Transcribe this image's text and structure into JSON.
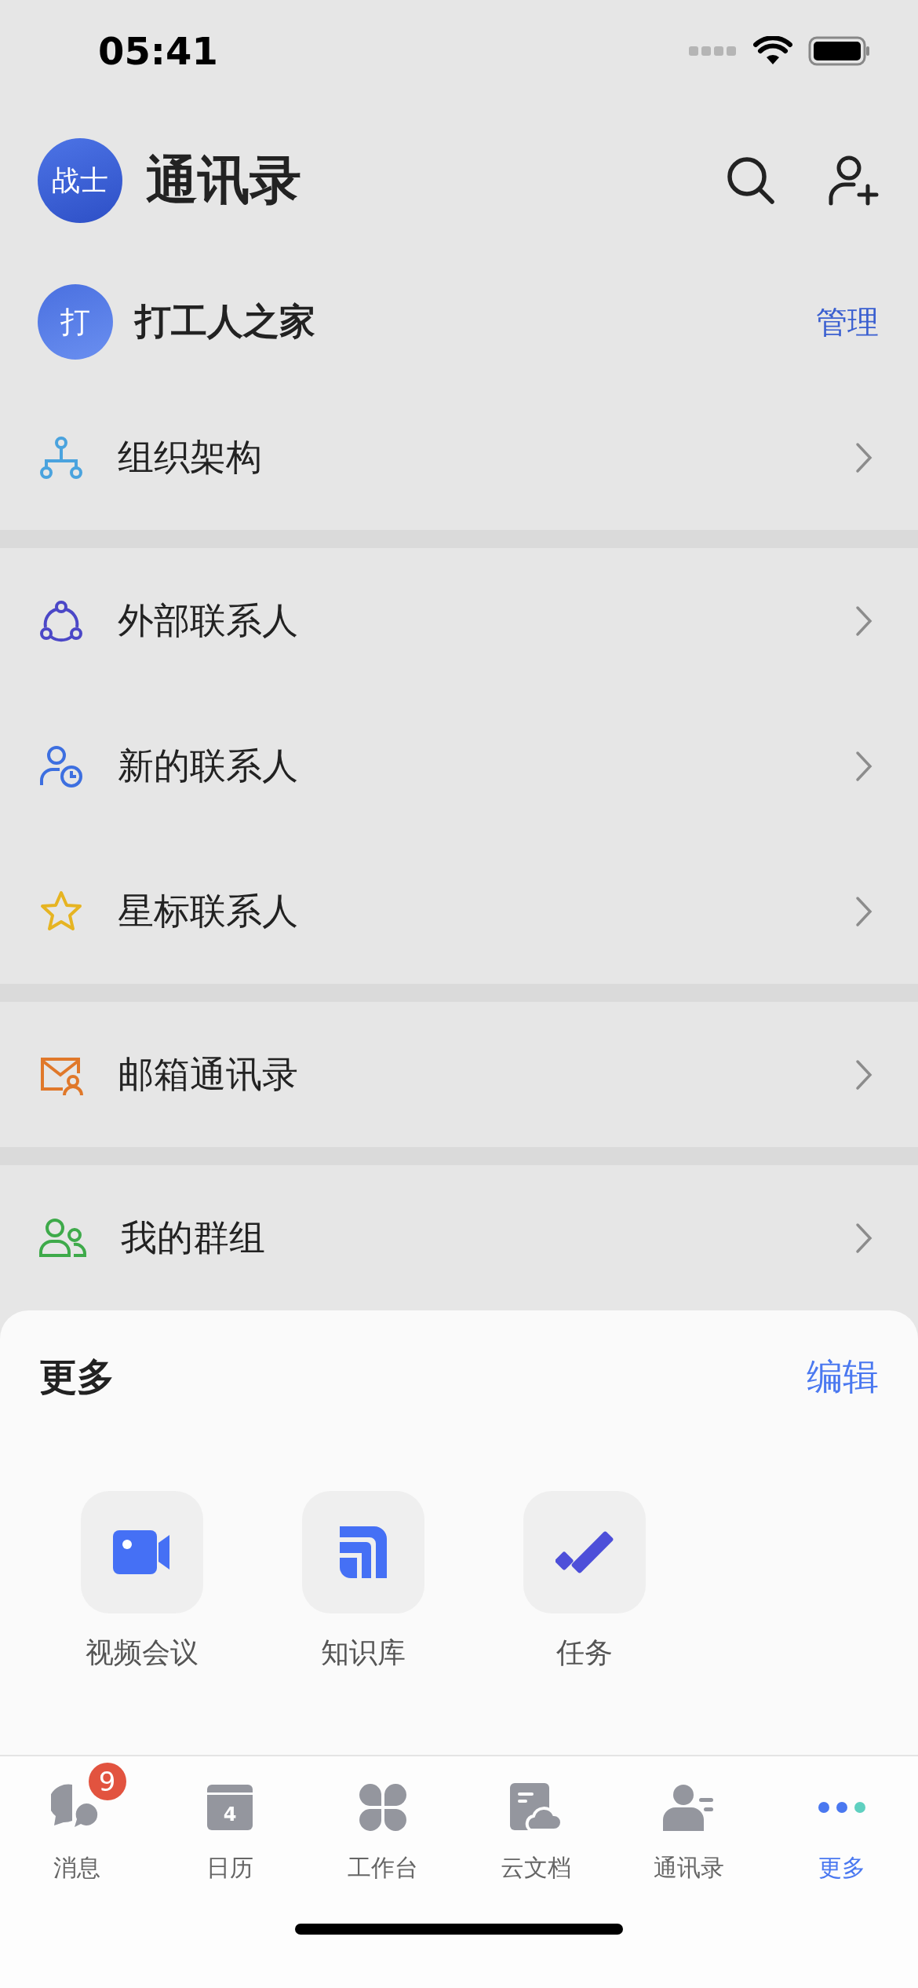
{
  "status_bar": {
    "time": "05:41"
  },
  "header": {
    "avatar": "战士",
    "title": "通讯录"
  },
  "org": {
    "avatar": "打",
    "name": "打工人之家",
    "action": "管理",
    "items": [
      {
        "label": "组织架构",
        "kind": "org"
      }
    ]
  },
  "sections": [
    {
      "items": [
        {
          "label": "外部联系人",
          "kind": "external"
        },
        {
          "label": "新的联系人",
          "kind": "new"
        },
        {
          "label": "星标联系人",
          "kind": "star"
        }
      ]
    },
    {
      "items": [
        {
          "label": "邮箱通讯录",
          "kind": "mail"
        }
      ]
    },
    {
      "items": [
        {
          "label": "我的群组",
          "kind": "group"
        }
      ]
    }
  ],
  "more_sheet": {
    "title": "更多",
    "action": "编辑",
    "apps": [
      {
        "label": "视频会议",
        "kind": "video"
      },
      {
        "label": "知识库",
        "kind": "wiki"
      },
      {
        "label": "任务",
        "kind": "task"
      }
    ]
  },
  "tab_bar": [
    {
      "label": "消息",
      "kind": "chat",
      "badge": "9",
      "selected": false
    },
    {
      "label": "日历",
      "kind": "calendar",
      "icon_text": "4",
      "selected": false
    },
    {
      "label": "工作台",
      "kind": "grid",
      "selected": false
    },
    {
      "label": "云文档",
      "kind": "doc",
      "selected": false
    },
    {
      "label": "通讯录",
      "kind": "contact",
      "selected": false
    },
    {
      "label": "更多",
      "kind": "more",
      "selected": true
    }
  ]
}
